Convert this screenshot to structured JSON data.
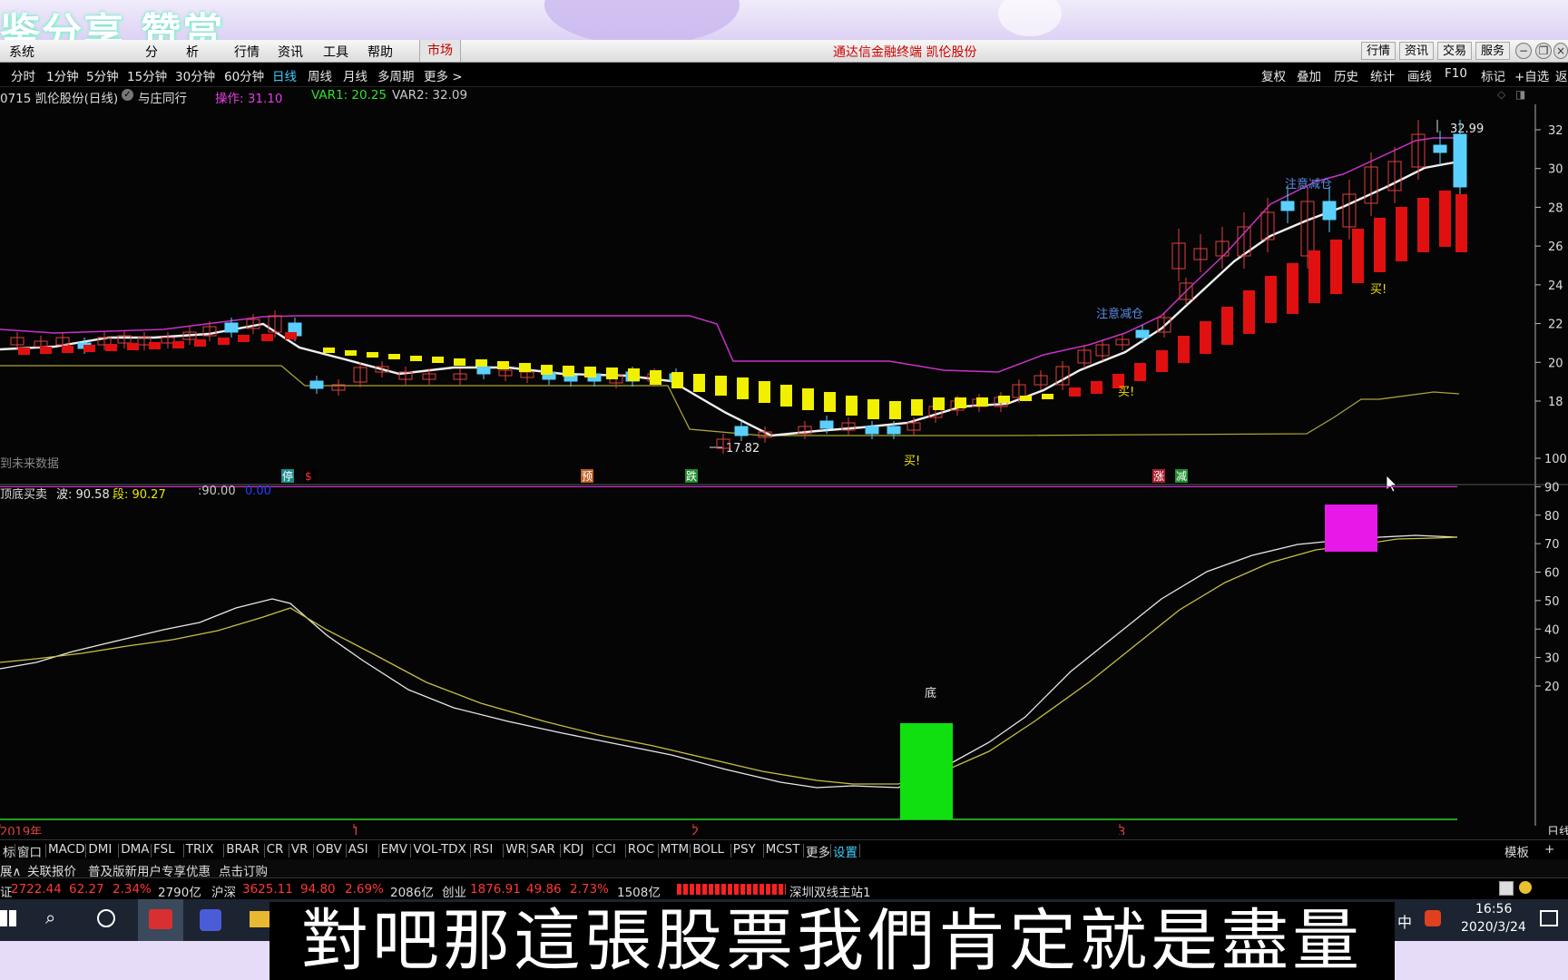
{
  "brand": {
    "text": "鉴分享 赞赏"
  },
  "menu": {
    "items": [
      "系统",
      "分",
      "析",
      "行情",
      "资讯",
      "工具",
      "帮助"
    ],
    "market_button": "市场",
    "title": "通达信金融终端 凯伦股份",
    "right_buttons": [
      "行情",
      "资讯",
      "交易",
      "服务"
    ]
  },
  "periods": [
    "分时",
    "1分钟",
    "5分钟",
    "15分钟",
    "30分钟",
    "60分钟",
    "日线",
    "周线",
    "月线",
    "多周期",
    "更多 >"
  ],
  "active_period": "日线",
  "tools": [
    "复权",
    "叠加",
    "历史",
    "统计",
    "画线",
    "F10",
    "标记",
    "+自选",
    "返"
  ],
  "info": {
    "stock": "0715 凯伦股份(日线)",
    "tag": "与庄同行",
    "op_label": "操作: 31.10",
    "var1": "VAR1: 20.25",
    "var2": "VAR2: 32.09",
    "colors": {
      "op": "#e040e0",
      "var1": "#2fe02f",
      "var2": "#c8c8c8"
    }
  },
  "main_chart": {
    "y_ticks": [
      "32",
      "30",
      "28",
      "26",
      "24",
      "22",
      "20",
      "18"
    ],
    "y_values": [
      32,
      30,
      28,
      26,
      24,
      22,
      20,
      18
    ],
    "high_label": "32.99",
    "low_label": "17.82",
    "no_future": "到未来数据",
    "notes": [
      {
        "text": "注意减仓",
        "color": "#5a8ce6"
      },
      {
        "text": "注意减仓",
        "color": "#5a8ce6"
      },
      {
        "text": "买!",
        "color": "#f0e000"
      },
      {
        "text": "买!",
        "color": "#f0e000"
      },
      {
        "text": "买!",
        "color": "#f0e000"
      }
    ],
    "signals": [
      {
        "text": "停",
        "bg": "#1c8c8c",
        "color": "#fff"
      },
      {
        "text": "$",
        "bg": "#000",
        "color": "#ff3030"
      },
      {
        "text": "预",
        "bg": "#c06020",
        "color": "#fff"
      },
      {
        "text": "跌",
        "bg": "#1f8f2f",
        "color": "#fff"
      },
      {
        "text": "涨",
        "bg": "#b02030",
        "color": "#fff"
      },
      {
        "text": "减",
        "bg": "#1f8f2f",
        "color": "#fff"
      }
    ]
  },
  "indicator": {
    "name": "顶底买卖",
    "bo": "波: 90.58",
    "duan": "段: 90.27",
    "level": ":90.00",
    "extra": "0.00",
    "bottom_label": "底",
    "y_ticks": [
      "100",
      "90",
      "80",
      "70",
      "60",
      "50",
      "40",
      "30",
      "20"
    ],
    "y_values": [
      100,
      90,
      80,
      70,
      60,
      50,
      40,
      30,
      20
    ]
  },
  "dates": {
    "labels": [
      "2019年",
      "1",
      "2",
      "3"
    ],
    "right": "日线"
  },
  "tabs": [
    "标",
    "窗口",
    "MACD",
    "DMI",
    "DMA",
    "FSL",
    "TRIX",
    "BRAR",
    "CR",
    "VR",
    "OBV",
    "ASI",
    "EMV",
    "VOL-TDX",
    "RSI",
    "WR",
    "SAR",
    "KDJ",
    "CCI",
    "ROC",
    "MTM",
    "BOLL",
    "PSY",
    "MCST",
    "更多",
    "设置"
  ],
  "tab_right": [
    "模板",
    "+"
  ],
  "links": [
    "展∧",
    "关联报价",
    "普及版新用户专享优惠",
    "点击订购"
  ],
  "indexes": [
    {
      "name": "证",
      "value": "2722.44",
      "change": "62.27",
      "pct": "2.34%",
      "volume": "2790亿"
    },
    {
      "name": "沪深",
      "value": "3625.11",
      "change": "94.80",
      "pct": "2.69%",
      "volume": "2086亿"
    },
    {
      "name": "创业",
      "value": "1876.91",
      "change": "49.86",
      "pct": "2.73%",
      "volume": "1508亿"
    }
  ],
  "server": "深圳双线主站1",
  "taskbar": {
    "ime": "中",
    "time": "16:56",
    "date": "2020/3/24"
  },
  "subtitle": "對吧那這張股票我們肯定就是盡量"
}
